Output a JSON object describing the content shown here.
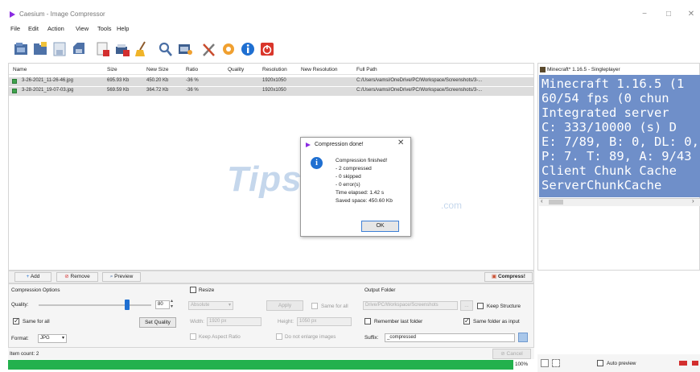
{
  "window": {
    "title": "Caesium - Image Compressor",
    "min_glyph": "−",
    "max_glyph": "□",
    "close_glyph": "✕"
  },
  "menu": [
    "File",
    "Edit",
    "Action",
    "View",
    "Tools",
    "Help"
  ],
  "toolbar": {
    "icons": [
      "open-image-icon",
      "open-folder-icon",
      "save-list-icon",
      "save-icon",
      "remove-item-icon",
      "clear-list-icon",
      "broom-icon",
      "search-icon",
      "compress-icon",
      "tools-icon",
      "settings-icon",
      "about-icon",
      "exit-icon"
    ]
  },
  "table": {
    "columns": [
      "Name",
      "Size",
      "New Size",
      "Ratio",
      "Quality",
      "Resolution",
      "New Resolution",
      "Full Path"
    ],
    "rows": [
      {
        "name": "3-26-2021_11-26-46.jpg",
        "size": "695.93 Kb",
        "new_size": "450.20 Kb",
        "ratio": "-36 %",
        "quality": "",
        "resolution": "1920x1050",
        "new_resolution": "",
        "path": "C:/Users/vamsi/OneDrive/PC/Workspace/Screenshots/3-..."
      },
      {
        "name": "3-28-2021_19-07-03.jpg",
        "size": "569.59 Kb",
        "new_size": "364.72 Kb",
        "ratio": "-36 %",
        "quality": "",
        "resolution": "1920x1050",
        "new_resolution": "",
        "path": "C:/Users/vamsi/OneDrive/PC/Workspace/Screenshots/3-..."
      }
    ]
  },
  "watermark": {
    "text": "TipsMake",
    "suffix": ".com"
  },
  "dialog": {
    "title": "Compression done!",
    "lines": [
      "Compression finished!",
      "- 2 compressed",
      "- 0 skipped",
      "- 0 error(s)",
      "Time elapsed: 1.42 s",
      "Saved space: 450.60 Kb"
    ],
    "ok_label": "OK"
  },
  "preview_panel": {
    "title": "Minecraft* 1.16.5 - Singleplayer",
    "lines": [
      "Minecraft 1.16.5 (1",
      "60/54 fps (0 chun",
      "Integrated server",
      "C: 333/10000 (s) D",
      "E: 7/89, B: 0, DL: 0,",
      "P: 7. T: 89, A: 9/43",
      "Client Chunk Cache",
      "ServerChunkCache"
    ],
    "scroll_left": "‹",
    "scroll_right": "›",
    "auto_preview_label": "Auto preview"
  },
  "actions": {
    "add_label": "Add",
    "remove_label": "Remove",
    "preview_label": "Preview",
    "compress_label": "Compress!"
  },
  "compression": {
    "title": "Compression Options",
    "quality_label": "Quality:",
    "quality_value": "80",
    "quality_fraction": 0.8,
    "same_for_all_label": "Same for all",
    "set_quality_label": "Set Quality",
    "format_label": "Format:",
    "format_value": "JPG"
  },
  "resize": {
    "title": "Resize",
    "mode_value": "Absolute",
    "apply_label": "Apply",
    "same_for_all_label": "Same for all",
    "width_label": "Width:",
    "width_value": "1920 px",
    "height_label": "Height:",
    "height_value": "1050 px",
    "keep_ratio_label": "Keep Aspect Ratio",
    "no_enlarge_label": "Do not enlarge images"
  },
  "output": {
    "title": "Output Folder",
    "folder_value": "Drive/PC/Workspace/Screenshots",
    "browse_label": "...",
    "keep_structure_label": "Keep Structure",
    "remember_label": "Remember last folder",
    "same_folder_label": "Same folder as input",
    "suffix_label": "Suffix:",
    "suffix_value": "_compressed"
  },
  "status": {
    "item_count": "Item count: 2",
    "cancel_label": "Cancel",
    "progress_text": "100%",
    "progress_fraction": 1.0
  }
}
